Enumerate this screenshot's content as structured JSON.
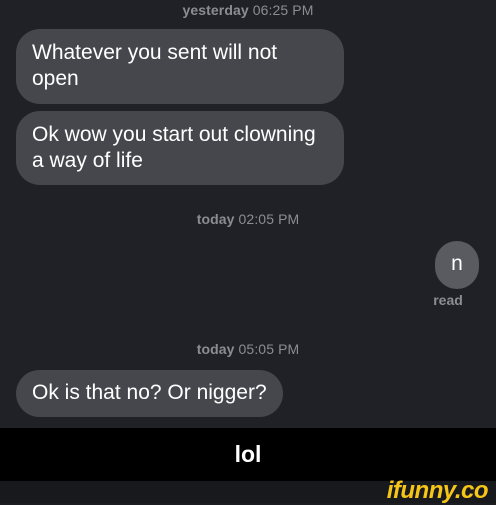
{
  "messages": {
    "group1": {
      "day": "yesterday",
      "time": "06:25 PM",
      "bubbles": [
        "Whatever you sent will not open",
        "Ok wow you start out clowning a way of life"
      ]
    },
    "group2": {
      "day": "today",
      "time": "02:05 PM",
      "outgoing": "n",
      "status": "read"
    },
    "group3": {
      "day": "today",
      "time": "05:05 PM",
      "bubbles": [
        "Ok is that no? Or nigger?"
      ]
    }
  },
  "caption": "lol",
  "watermark": "ifunny.co",
  "colors": {
    "background": "#1f2126",
    "incoming_bubble": "#45474c",
    "outgoing_bubble": "#595b60",
    "caption_bar": "#000000",
    "watermark": "#f5c518"
  }
}
